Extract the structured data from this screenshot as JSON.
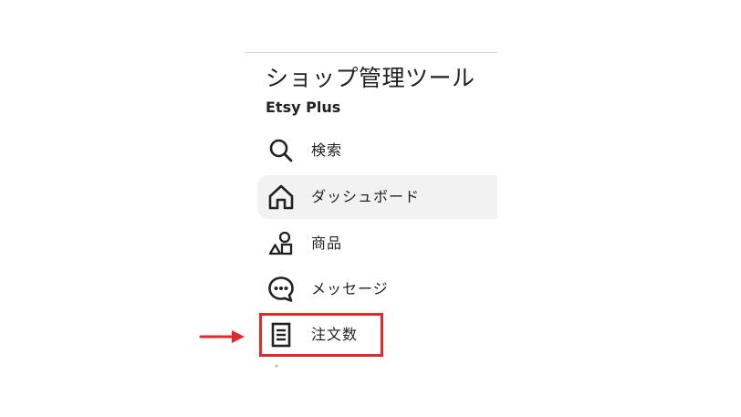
{
  "header": {
    "title": "ショップ管理ツール",
    "subtitle": "Etsy Plus"
  },
  "nav": {
    "items": [
      {
        "label": "検索",
        "icon": "search-icon",
        "active": false
      },
      {
        "label": "ダッシュボード",
        "icon": "home-icon",
        "active": true
      },
      {
        "label": "商品",
        "icon": "shapes-icon",
        "active": false
      },
      {
        "label": "メッセージ",
        "icon": "chat-bubble-icon",
        "active": false
      },
      {
        "label": "注文数",
        "icon": "document-icon",
        "active": false
      }
    ]
  },
  "annotation": {
    "highlight_color": "#e22a2a",
    "arrow_color": "#e22a2a"
  },
  "colors": {
    "active_background": "#f2f2f2",
    "text": "#222222",
    "divider": "#d8d8d8"
  }
}
